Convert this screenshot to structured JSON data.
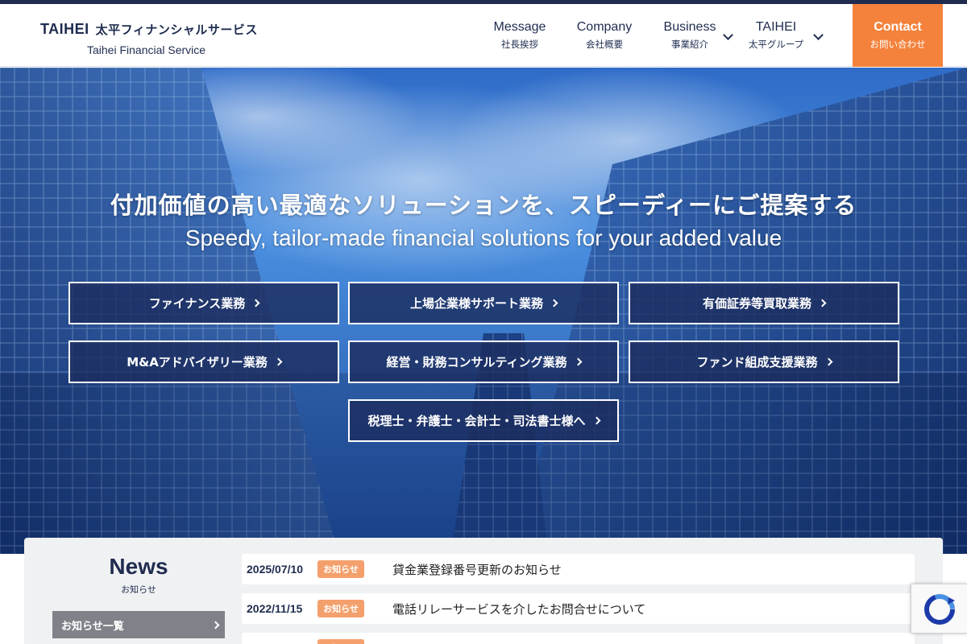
{
  "header": {
    "logo_en": "TAIHEI",
    "logo_jp": "太平フィナンシャルサービス",
    "logo_sub": "Taihei Financial Service",
    "nav": [
      {
        "en": "Message",
        "jp": "社長挨拶"
      },
      {
        "en": "Company",
        "jp": "会社概要"
      },
      {
        "en": "Business",
        "jp": "事業紹介"
      },
      {
        "en": "TAIHEI",
        "jp": "太平グループ"
      }
    ],
    "contact": {
      "en": "Contact",
      "jp": "お問い合わせ"
    }
  },
  "hero": {
    "title": "付加価値の高い最適なソリューションを、スピーディーにご提案する",
    "subtitle": "Speedy, tailor-made financial solutions for your added value",
    "services": [
      "ファイナンス業務",
      "上場企業様サポート業務",
      "有価証券等買取業務",
      "M&Aアドバイザリー業務",
      "経営・財務コンサルティング業務",
      "ファンド組成支援業務",
      "税理士・弁護士・会計士・司法書士様へ"
    ]
  },
  "news": {
    "title": "News",
    "title_jp": "お知らせ",
    "all_label": "お知らせ一覧",
    "items": [
      {
        "date": "2025/07/10",
        "badge": "お知らせ",
        "text": "貸金業登録番号更新のお知らせ"
      },
      {
        "date": "2022/11/15",
        "badge": "お知らせ",
        "text": "電話リレーサービスを介したお問合せについて"
      }
    ]
  },
  "colors": {
    "navy": "#1f2c4f",
    "accent_orange": "#f4823c",
    "badge_orange": "#f4a06c"
  },
  "icons": [
    "chevron-down-icon",
    "chevron-right-icon",
    "recaptcha-icon"
  ]
}
